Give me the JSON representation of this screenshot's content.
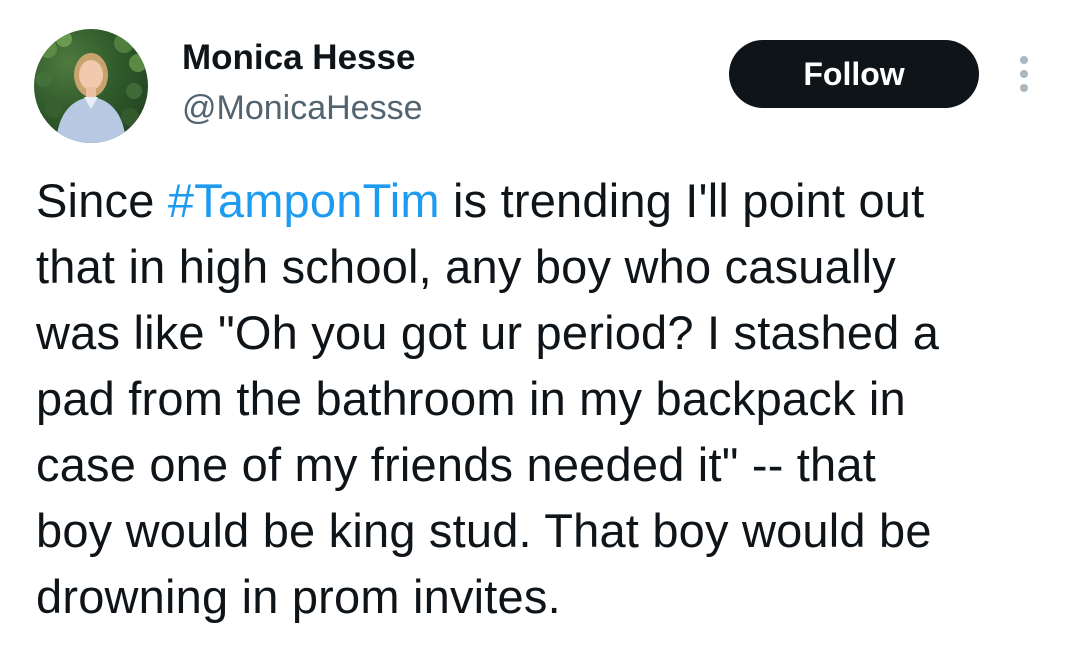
{
  "author": {
    "display_name": "Monica Hesse",
    "handle": "@MonicaHesse"
  },
  "actions": {
    "follow_label": "Follow",
    "more_icon": "more-vertical-icon"
  },
  "tweet": {
    "line1_before": "Since ",
    "hashtag": "#TamponTim",
    "line1_after": " is trending I'll point out",
    "lines": [
      "that in high school, any boy who casually",
      "was like \"Oh you got ur period? I stashed a",
      "pad from the bathroom in my backpack in",
      "case one of my friends needed it\" -- that",
      "boy would be king stud. That boy would be",
      "drowning in prom invites."
    ]
  },
  "colors": {
    "text": "#0f1419",
    "secondary": "#536471",
    "link": "#1d9bf0",
    "button_bg": "#0f1419",
    "button_text": "#ffffff"
  }
}
